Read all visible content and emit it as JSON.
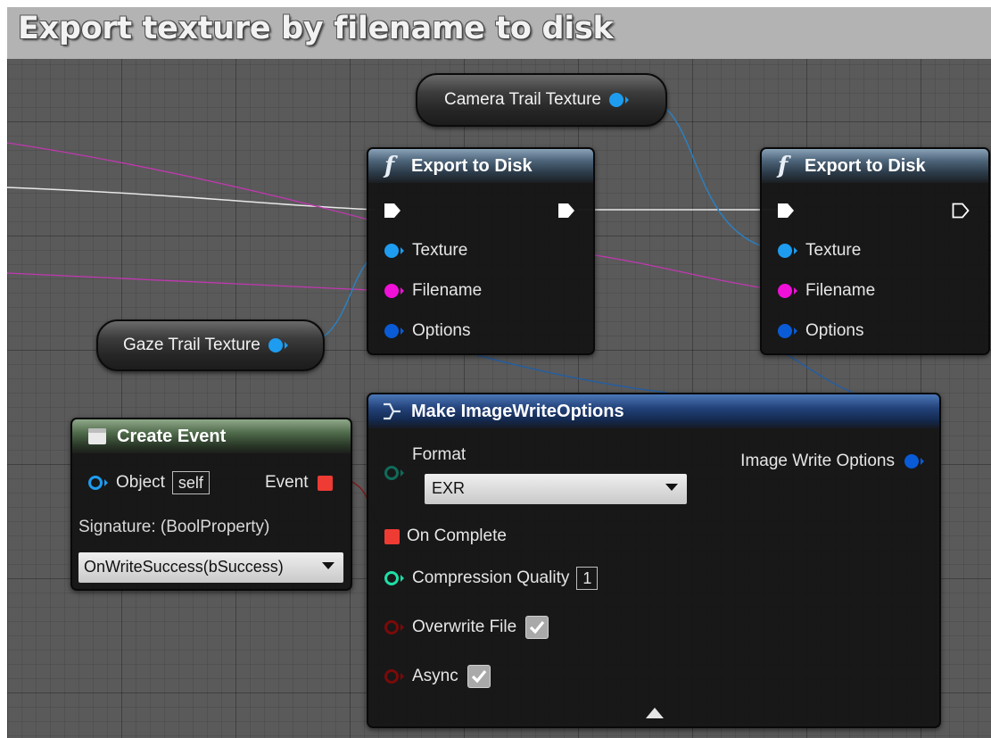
{
  "comment": {
    "title": "Export texture by filename to disk"
  },
  "camera_var": {
    "label": "Camera Trail Texture"
  },
  "gaze_var": {
    "label": "Gaze Trail Texture"
  },
  "export_node_1": {
    "title": "Export to Disk",
    "icon": "function-icon",
    "pins": {
      "texture": "Texture",
      "filename": "Filename",
      "options": "Options"
    }
  },
  "export_node_2": {
    "title": "Export to Disk",
    "icon": "function-icon",
    "pins": {
      "texture": "Texture",
      "filename": "Filename",
      "options": "Options"
    }
  },
  "create_event": {
    "title": "Create Event",
    "object_label": "Object",
    "object_value": "self",
    "event_label": "Event",
    "signature": "Signature: (BoolProperty)",
    "selected_function": "OnWriteSuccess(bSuccess)"
  },
  "make_options": {
    "title": "Make ImageWriteOptions",
    "format_label": "Format",
    "format_value": "EXR",
    "output_label": "Image Write Options",
    "on_complete": "On Complete",
    "compression_label": "Compression Quality",
    "compression_value": "1",
    "overwrite_label": "Overwrite File",
    "overwrite_checked": true,
    "async_label": "Async",
    "async_checked": true
  },
  "colors": {
    "exec": "#ffffff",
    "texture_pin": "#1e9cf0",
    "string_pin": "#f010d8",
    "struct_pin": "#0a5bd6",
    "delegate_pin": "#ee3b33",
    "int_pin": "#1fdfa6",
    "bool_pin": "#7a0a0a"
  }
}
